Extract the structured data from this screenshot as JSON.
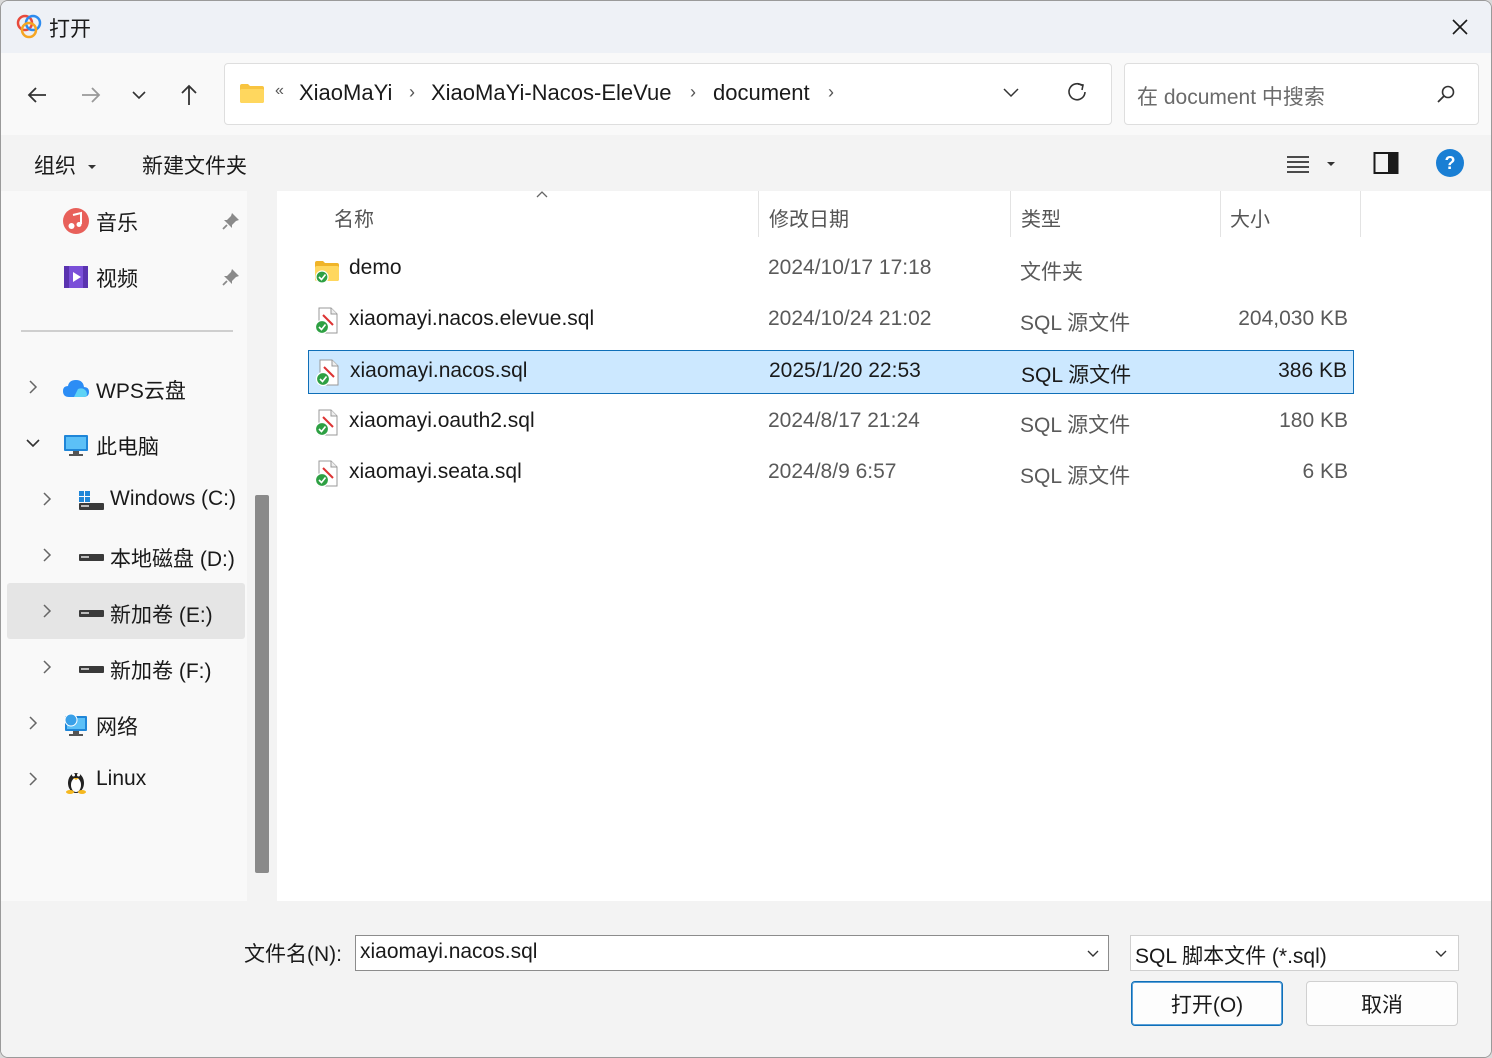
{
  "window": {
    "title": "打开"
  },
  "nav": {
    "breadcrumb_overflow": "«",
    "breadcrumbs": [
      "XiaoMaYi",
      "XiaoMaYi-Nacos-EleVue",
      "document"
    ],
    "separator": "›"
  },
  "search": {
    "placeholder": "在 document 中搜索"
  },
  "command_bar": {
    "organize": "组织",
    "new_folder": "新建文件夹"
  },
  "sidebar": {
    "quick": [
      {
        "label": "音乐",
        "icon": "music-icon"
      },
      {
        "label": "视频",
        "icon": "video-icon"
      }
    ],
    "tree": [
      {
        "label": "WPS云盘",
        "icon": "cloud-icon"
      },
      {
        "label": "此电脑",
        "icon": "computer-icon"
      },
      {
        "label": "Windows (C:)",
        "icon": "windows-drive-icon"
      },
      {
        "label": "本地磁盘 (D:)",
        "icon": "drive-icon"
      },
      {
        "label": "新加卷 (E:)",
        "icon": "drive-icon"
      },
      {
        "label": "新加卷 (F:)",
        "icon": "drive-icon"
      },
      {
        "label": "网络",
        "icon": "network-icon"
      },
      {
        "label": "Linux",
        "icon": "linux-icon"
      }
    ]
  },
  "columns": {
    "name": "名称",
    "date": "修改日期",
    "type": "类型",
    "size": "大小"
  },
  "files": [
    {
      "name": "demo",
      "date": "2024/10/17 17:18",
      "type": "文件夹",
      "size": "",
      "icon": "folder-icon"
    },
    {
      "name": "xiaomayi.nacos.elevue.sql",
      "date": "2024/10/24 21:02",
      "type": "SQL 源文件",
      "size": "204,030 KB",
      "icon": "sql-file-icon"
    },
    {
      "name": "xiaomayi.nacos.sql",
      "date": "2025/1/20 22:53",
      "type": "SQL 源文件",
      "size": "386 KB",
      "icon": "sql-file-icon"
    },
    {
      "name": "xiaomayi.oauth2.sql",
      "date": "2024/8/17 21:24",
      "type": "SQL 源文件",
      "size": "180 KB",
      "icon": "sql-file-icon"
    },
    {
      "name": "xiaomayi.seata.sql",
      "date": "2024/8/9 6:57",
      "type": "SQL 源文件",
      "size": "6 KB",
      "icon": "sql-file-icon"
    }
  ],
  "selected_index": 2,
  "bottom": {
    "filename_label": "文件名(N):",
    "filename_value": "xiaomayi.nacos.sql",
    "filetype_value": "SQL 脚本文件 (*.sql)",
    "open_button": "打开(O)",
    "cancel_button": "取消"
  },
  "colors": {
    "selection_bg": "#cce8ff",
    "selection_border": "#0f6fb8",
    "help_blue": "#1a7fd4"
  }
}
